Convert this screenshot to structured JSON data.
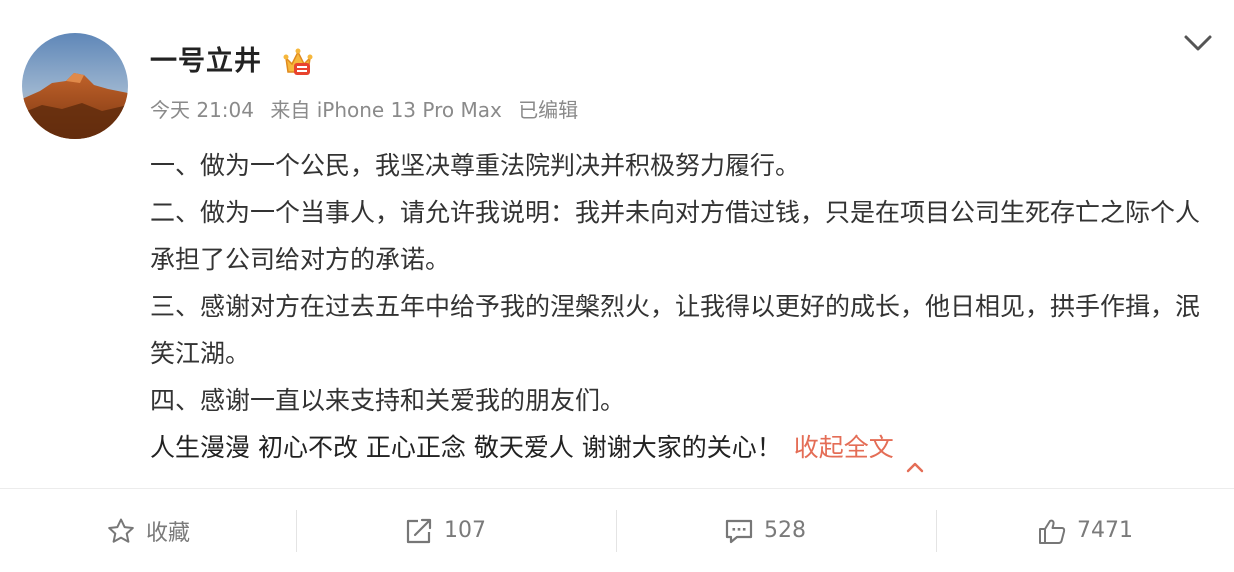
{
  "post": {
    "username": "一号立井",
    "time": "今天 21:04",
    "source": "来自 iPhone 13 Pro Max",
    "edited": "已编辑",
    "paragraphs": [
      "一、做为一个公民，我坚决尊重法院判决并积极努力履行。",
      "二、做为一个当事人，请允许我说明：我并未向对方借过钱，只是在项目公司生死存亡之际个人承担了公司给对方的承诺。",
      "三、感谢对方在过去五年中给予我的涅槃烈火，让我得以更好的成长，他日相见，拱手作揖，泯笑江湖。",
      "四、感谢一直以来支持和关爱我的朋友们。"
    ],
    "closing": "人生漫漫 初心不改 正心正念 敬天爱人 谢谢大家的关心！",
    "collapse_label": "收起全文",
    "accent_color": "#e46d56"
  },
  "actions": {
    "favorite_label": "收藏",
    "repost_count": "107",
    "comment_count": "528",
    "like_count": "7471"
  },
  "icons": [
    "avatar-image",
    "crown-badge-icon",
    "chevron-down-icon",
    "chevron-up-icon",
    "star-icon",
    "repost-icon",
    "comment-icon",
    "thumbs-up-icon"
  ]
}
